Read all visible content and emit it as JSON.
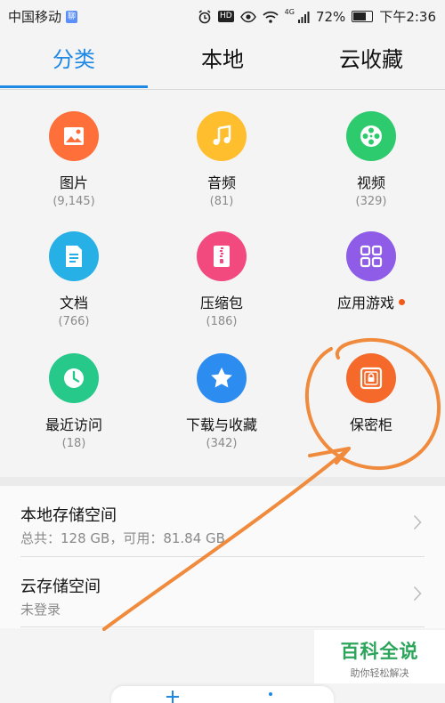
{
  "status_bar": {
    "carrier": "中国移动",
    "carrier_badge": "聊",
    "hd": "HD",
    "network": "4G",
    "battery": "72%",
    "time": "下午2:36"
  },
  "tabs": [
    {
      "label": "分类",
      "active": true
    },
    {
      "label": "本地",
      "active": false
    },
    {
      "label": "云收藏",
      "active": false
    }
  ],
  "categories": [
    {
      "label": "图片",
      "count": "(9,145)",
      "icon": "image-icon",
      "color": "#ff6f3a"
    },
    {
      "label": "音频",
      "count": "(81)",
      "icon": "music-note-icon",
      "color": "#ffbe2e"
    },
    {
      "label": "视频",
      "count": "(329)",
      "icon": "film-reel-icon",
      "color": "#2dcb6e"
    },
    {
      "label": "文档",
      "count": "(766)",
      "icon": "document-icon",
      "color": "#27b0e6"
    },
    {
      "label": "压缩包",
      "count": "(186)",
      "icon": "zip-icon",
      "color": "#f2497f"
    },
    {
      "label": "应用游戏",
      "count": "",
      "icon": "apps-grid-icon",
      "color": "#8f5ce8",
      "new_dot": true
    },
    {
      "label": "最近访问",
      "count": "(18)",
      "icon": "clock-icon",
      "color": "#26c98a"
    },
    {
      "label": "下载与收藏",
      "count": "(342)",
      "icon": "star-icon",
      "color": "#2d8cf0"
    },
    {
      "label": "保密柜",
      "count": "",
      "icon": "safe-lock-icon",
      "color": "#f56a2a"
    }
  ],
  "storage": [
    {
      "title": "本地存储空间",
      "subtitle": "总共：128 GB，可用：81.84 GB"
    },
    {
      "title": "云存储空间",
      "subtitle": "未登录"
    }
  ],
  "watermark": {
    "title": "百科全说",
    "subtitle": "助你轻松解决"
  },
  "colors": {
    "accent": "#1e88e5",
    "annotation": "#f08a3c"
  }
}
